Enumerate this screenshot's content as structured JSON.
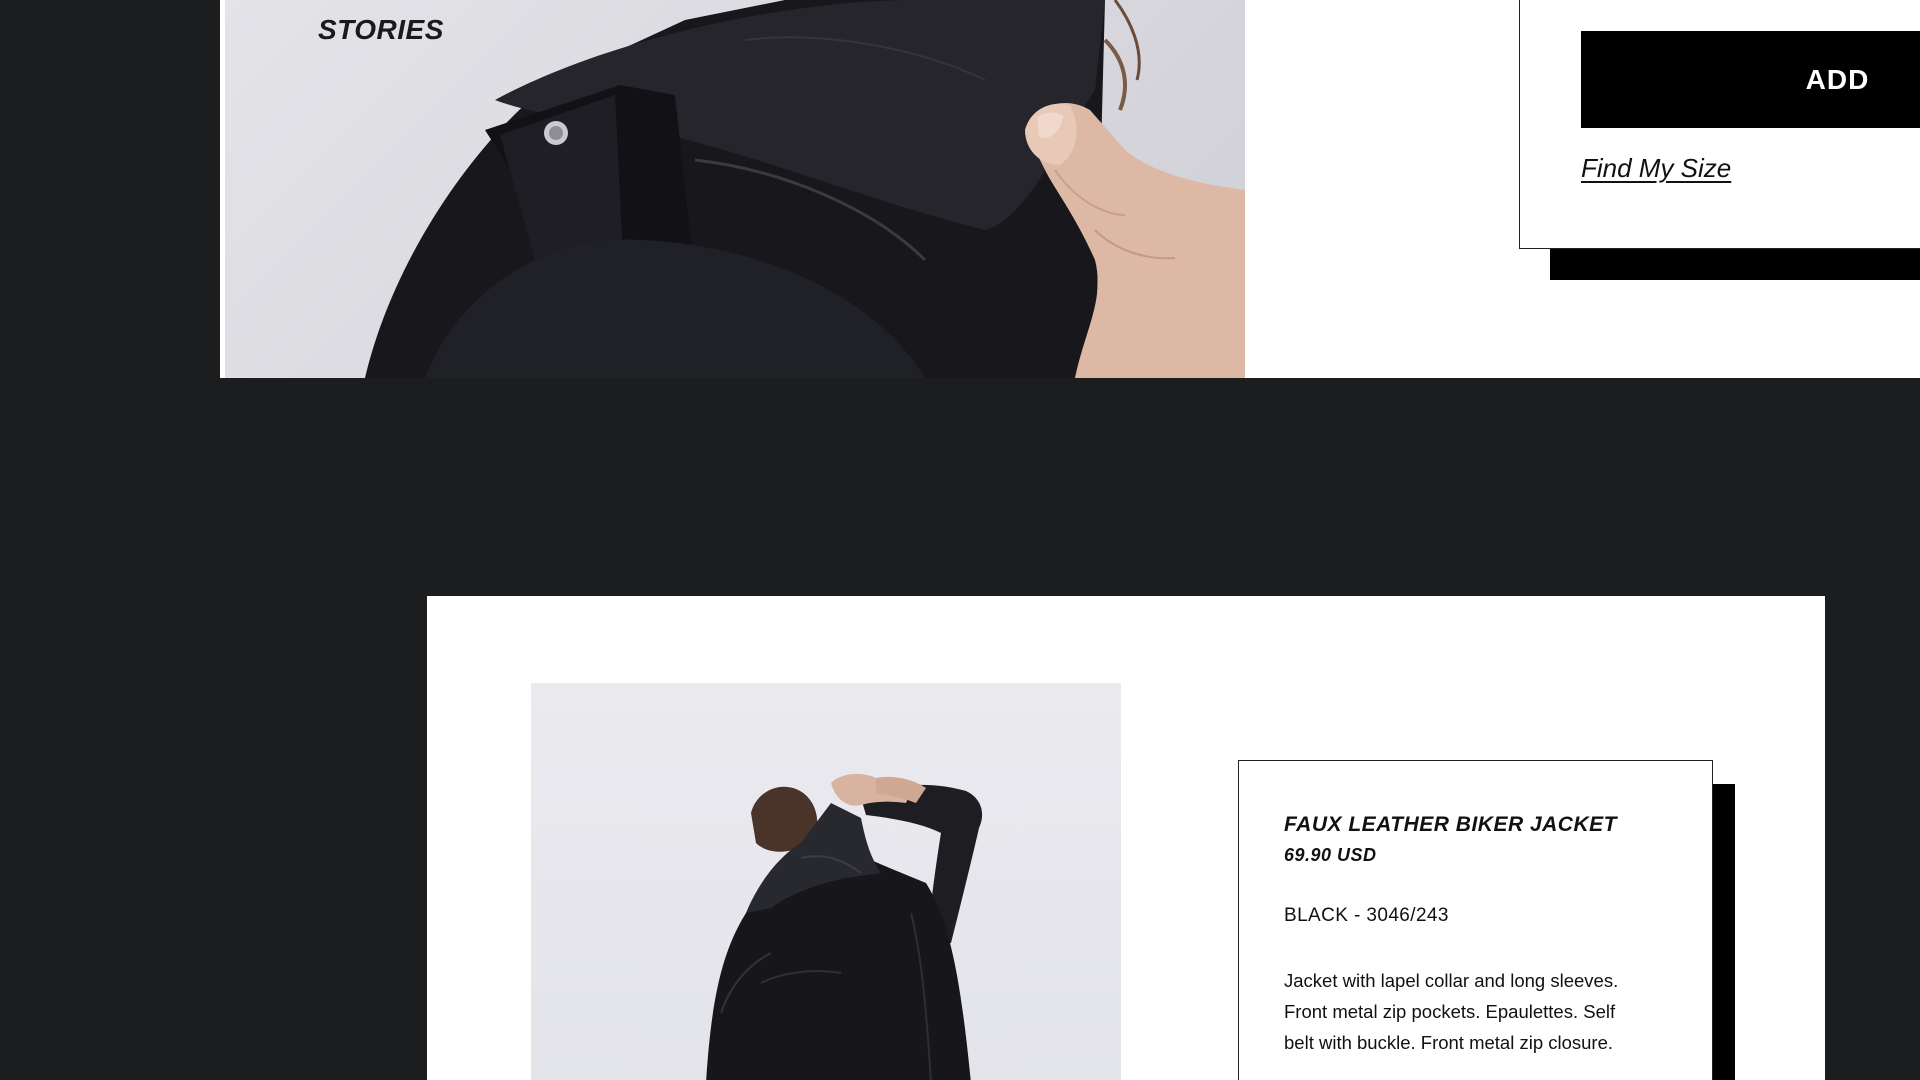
{
  "colors": {
    "page_background": "#1c1d1f",
    "panel_background": "#ffffff",
    "button_background": "#000000",
    "button_text": "#ffffff",
    "text": "#111111"
  },
  "top_section": {
    "photo_overlay_label": "STORIES",
    "add_button_label": "ADD",
    "find_size_link": "Find My Size"
  },
  "product": {
    "title": "FAUX LEATHER BIKER JACKET",
    "price": "69.90 USD",
    "color_ref": "BLACK - 3046/243",
    "description_lines": [
      "Jacket with lapel collar and long sleeves.",
      "Front metal zip pockets. Epaulettes. Self",
      "belt with buckle. Front metal zip closure."
    ]
  },
  "icons": {
    "top_photo": "jacket-collar-closeup-photo",
    "bottom_photo": "model-back-view-photo"
  }
}
